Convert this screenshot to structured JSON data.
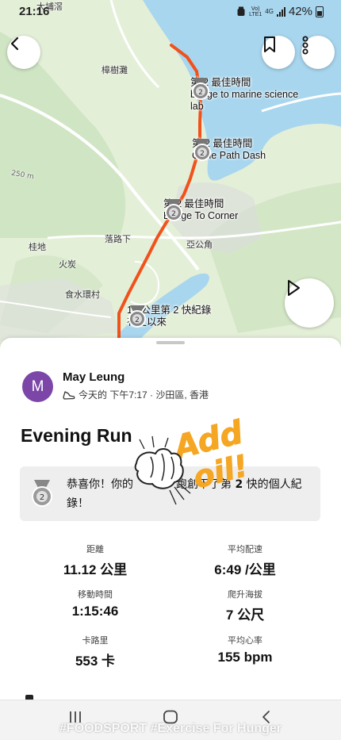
{
  "status_bar": {
    "time": "21:16",
    "network_top": "Vo)",
    "network_bottom": "LTE1",
    "signal_type": "4G",
    "battery": "42%"
  },
  "map": {
    "place_labels": [
      "大埔滘",
      "樟樹灘",
      "桂地",
      "落路下",
      "亞公角",
      "火炭",
      "食水環村",
      "250 m"
    ],
    "segments": [
      {
        "rank": "2",
        "title": "第 2 最佳時間",
        "name": "bridge to marine science lab"
      },
      {
        "rank": "2",
        "title": "第 2 最佳時間",
        "name": "Cycle Path Dash"
      },
      {
        "rank": "2",
        "title": "第 2 最佳時間",
        "name": "Bridge To Corner"
      },
      {
        "rank": "2",
        "title": "10 公里第 2 快紀錄",
        "name": "有史以來"
      }
    ],
    "colors": {
      "route": "#f1511b",
      "water": "#a8d6ee",
      "land": "#e3efd7"
    }
  },
  "activity": {
    "avatar_initial": "M",
    "athlete": "May Leung",
    "meta": "今天的 下午7:17 · 沙田區, 香港",
    "title": "Evening Run",
    "achievement_pre": "恭喜你！你的",
    "achievement_mid": "跑創下了第",
    "achievement_num": "2",
    "achievement_post": "快的個人紀錄！",
    "stats": [
      {
        "label": "距離",
        "value": "11.12 公里"
      },
      {
        "label": "平均配速",
        "value": "6:49 /公里"
      },
      {
        "label": "移動時間",
        "value": "1:15:46"
      },
      {
        "label": "爬升海拔",
        "value": "7 公尺"
      },
      {
        "label": "卡路里",
        "value": "553 卡"
      },
      {
        "label": "平均心率",
        "value": "155 bpm"
      }
    ]
  },
  "sticker": {
    "text_top": "Add",
    "text_bottom": "oil!",
    "color": "#f5a623"
  },
  "overlay_hashtag": "#FOODSPORT  #Exercise  For Hunger"
}
